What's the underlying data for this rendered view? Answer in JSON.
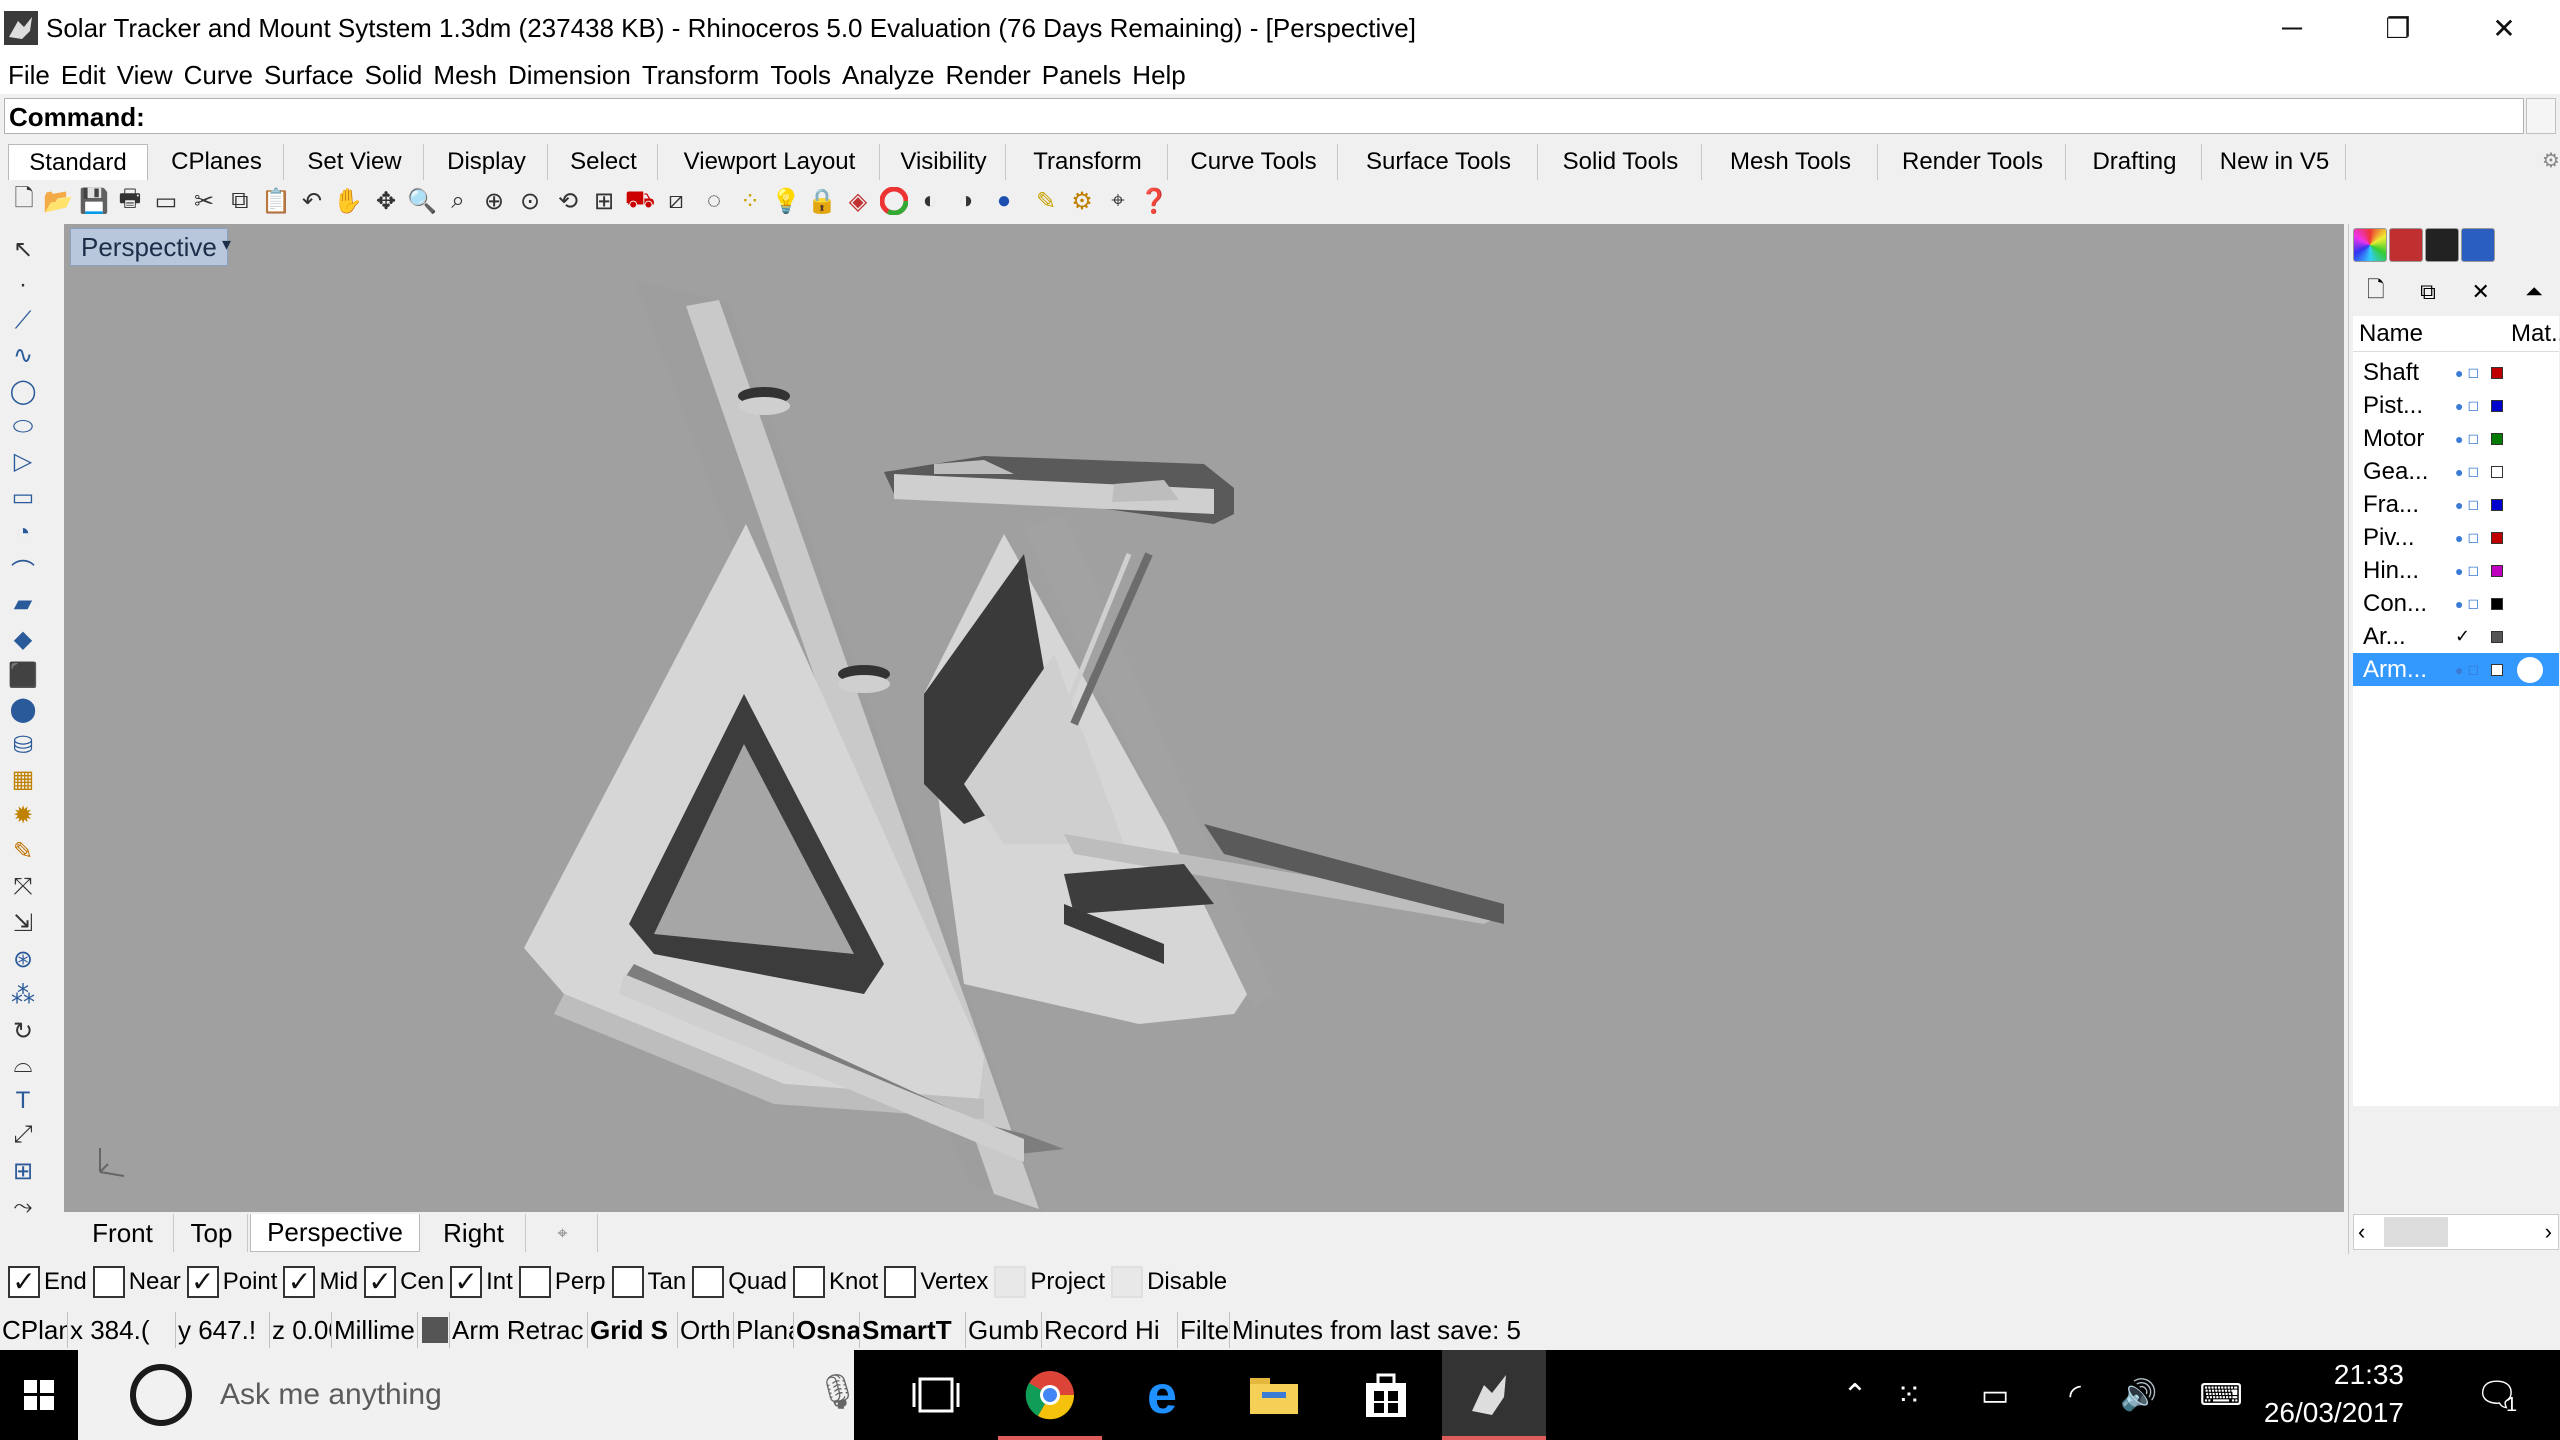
{
  "window": {
    "title": "Solar Tracker and Mount Sytstem 1.3dm (237438 KB) - Rhinoceros 5.0 Evaluation (76 Days Remaining) - [Perspective]",
    "controls": {
      "minimize": "─",
      "restore": "❐",
      "close": "✕"
    }
  },
  "menu": [
    "File",
    "Edit",
    "View",
    "Curve",
    "Surface",
    "Solid",
    "Mesh",
    "Dimension",
    "Transform",
    "Tools",
    "Analyze",
    "Render",
    "Panels",
    "Help"
  ],
  "command": {
    "label": "Command:",
    "value": ""
  },
  "toolbar_tabs": [
    "Standard",
    "CPlanes",
    "Set View",
    "Display",
    "Select",
    "Viewport Layout",
    "Visibility",
    "Transform",
    "Curve Tools",
    "Surface Tools",
    "Solid Tools",
    "Mesh Tools",
    "Render Tools",
    "Drafting",
    "New in V5"
  ],
  "active_toolbar_tab": "Standard",
  "viewport": {
    "label": "Perspective",
    "caret": "▾",
    "axis_icon": "axis-triad-icon"
  },
  "view_tabs": {
    "front": "Front",
    "top": "Top",
    "perspective": "Perspective",
    "right": "Right",
    "add": "⌖"
  },
  "active_view_tab": "Perspective",
  "osnaps": [
    {
      "label": "End",
      "checked": true
    },
    {
      "label": "Near",
      "checked": false
    },
    {
      "label": "Point",
      "checked": true
    },
    {
      "label": "Mid",
      "checked": true
    },
    {
      "label": "Cen",
      "checked": true
    },
    {
      "label": "Int",
      "checked": true
    },
    {
      "label": "Perp",
      "checked": false
    },
    {
      "label": "Tan",
      "checked": false
    },
    {
      "label": "Quad",
      "checked": false
    },
    {
      "label": "Knot",
      "checked": false
    },
    {
      "label": "Vertex",
      "checked": false
    },
    {
      "label": "Project",
      "checked": false,
      "disabled": true
    },
    {
      "label": "Disable",
      "checked": false,
      "disabled": true
    }
  ],
  "status": {
    "cplane": "CPlan",
    "x": "x 384.(",
    "y": "y 647.!",
    "z": "z 0.00(",
    "units": "Millime",
    "layer": "Arm Retrac",
    "grid_snap": "Grid S",
    "ortho": "Orth",
    "planar": "Plana",
    "osnap": "Osna",
    "smarttrack": "SmartT",
    "gumball": "Gumb",
    "record_history": "Record Hi",
    "filter": "Filte",
    "last_save": "Minutes from last save: 5"
  },
  "layers": {
    "header": {
      "name": "Name",
      "material": "Mat..."
    },
    "rows": [
      {
        "name": "Shaft",
        "color": "#c00000"
      },
      {
        "name": "Pist...",
        "color": "#0000cc"
      },
      {
        "name": "Motor",
        "color": "#007a00"
      },
      {
        "name": "Gea...",
        "color": "#ffffff"
      },
      {
        "name": "Fra...",
        "color": "#0000cc"
      },
      {
        "name": "Piv...",
        "color": "#c00000"
      },
      {
        "name": "Hin...",
        "color": "#c000c0"
      },
      {
        "name": "Con...",
        "color": "#000000"
      },
      {
        "name": "Ar...",
        "color": "#555555",
        "check": "✓"
      },
      {
        "name": "Arm...",
        "color": "#ffffff",
        "selected": true
      }
    ]
  },
  "taskbar": {
    "search_placeholder": "Ask me anything",
    "time": "21:33",
    "date": "26/03/2017",
    "notifications": "1"
  }
}
